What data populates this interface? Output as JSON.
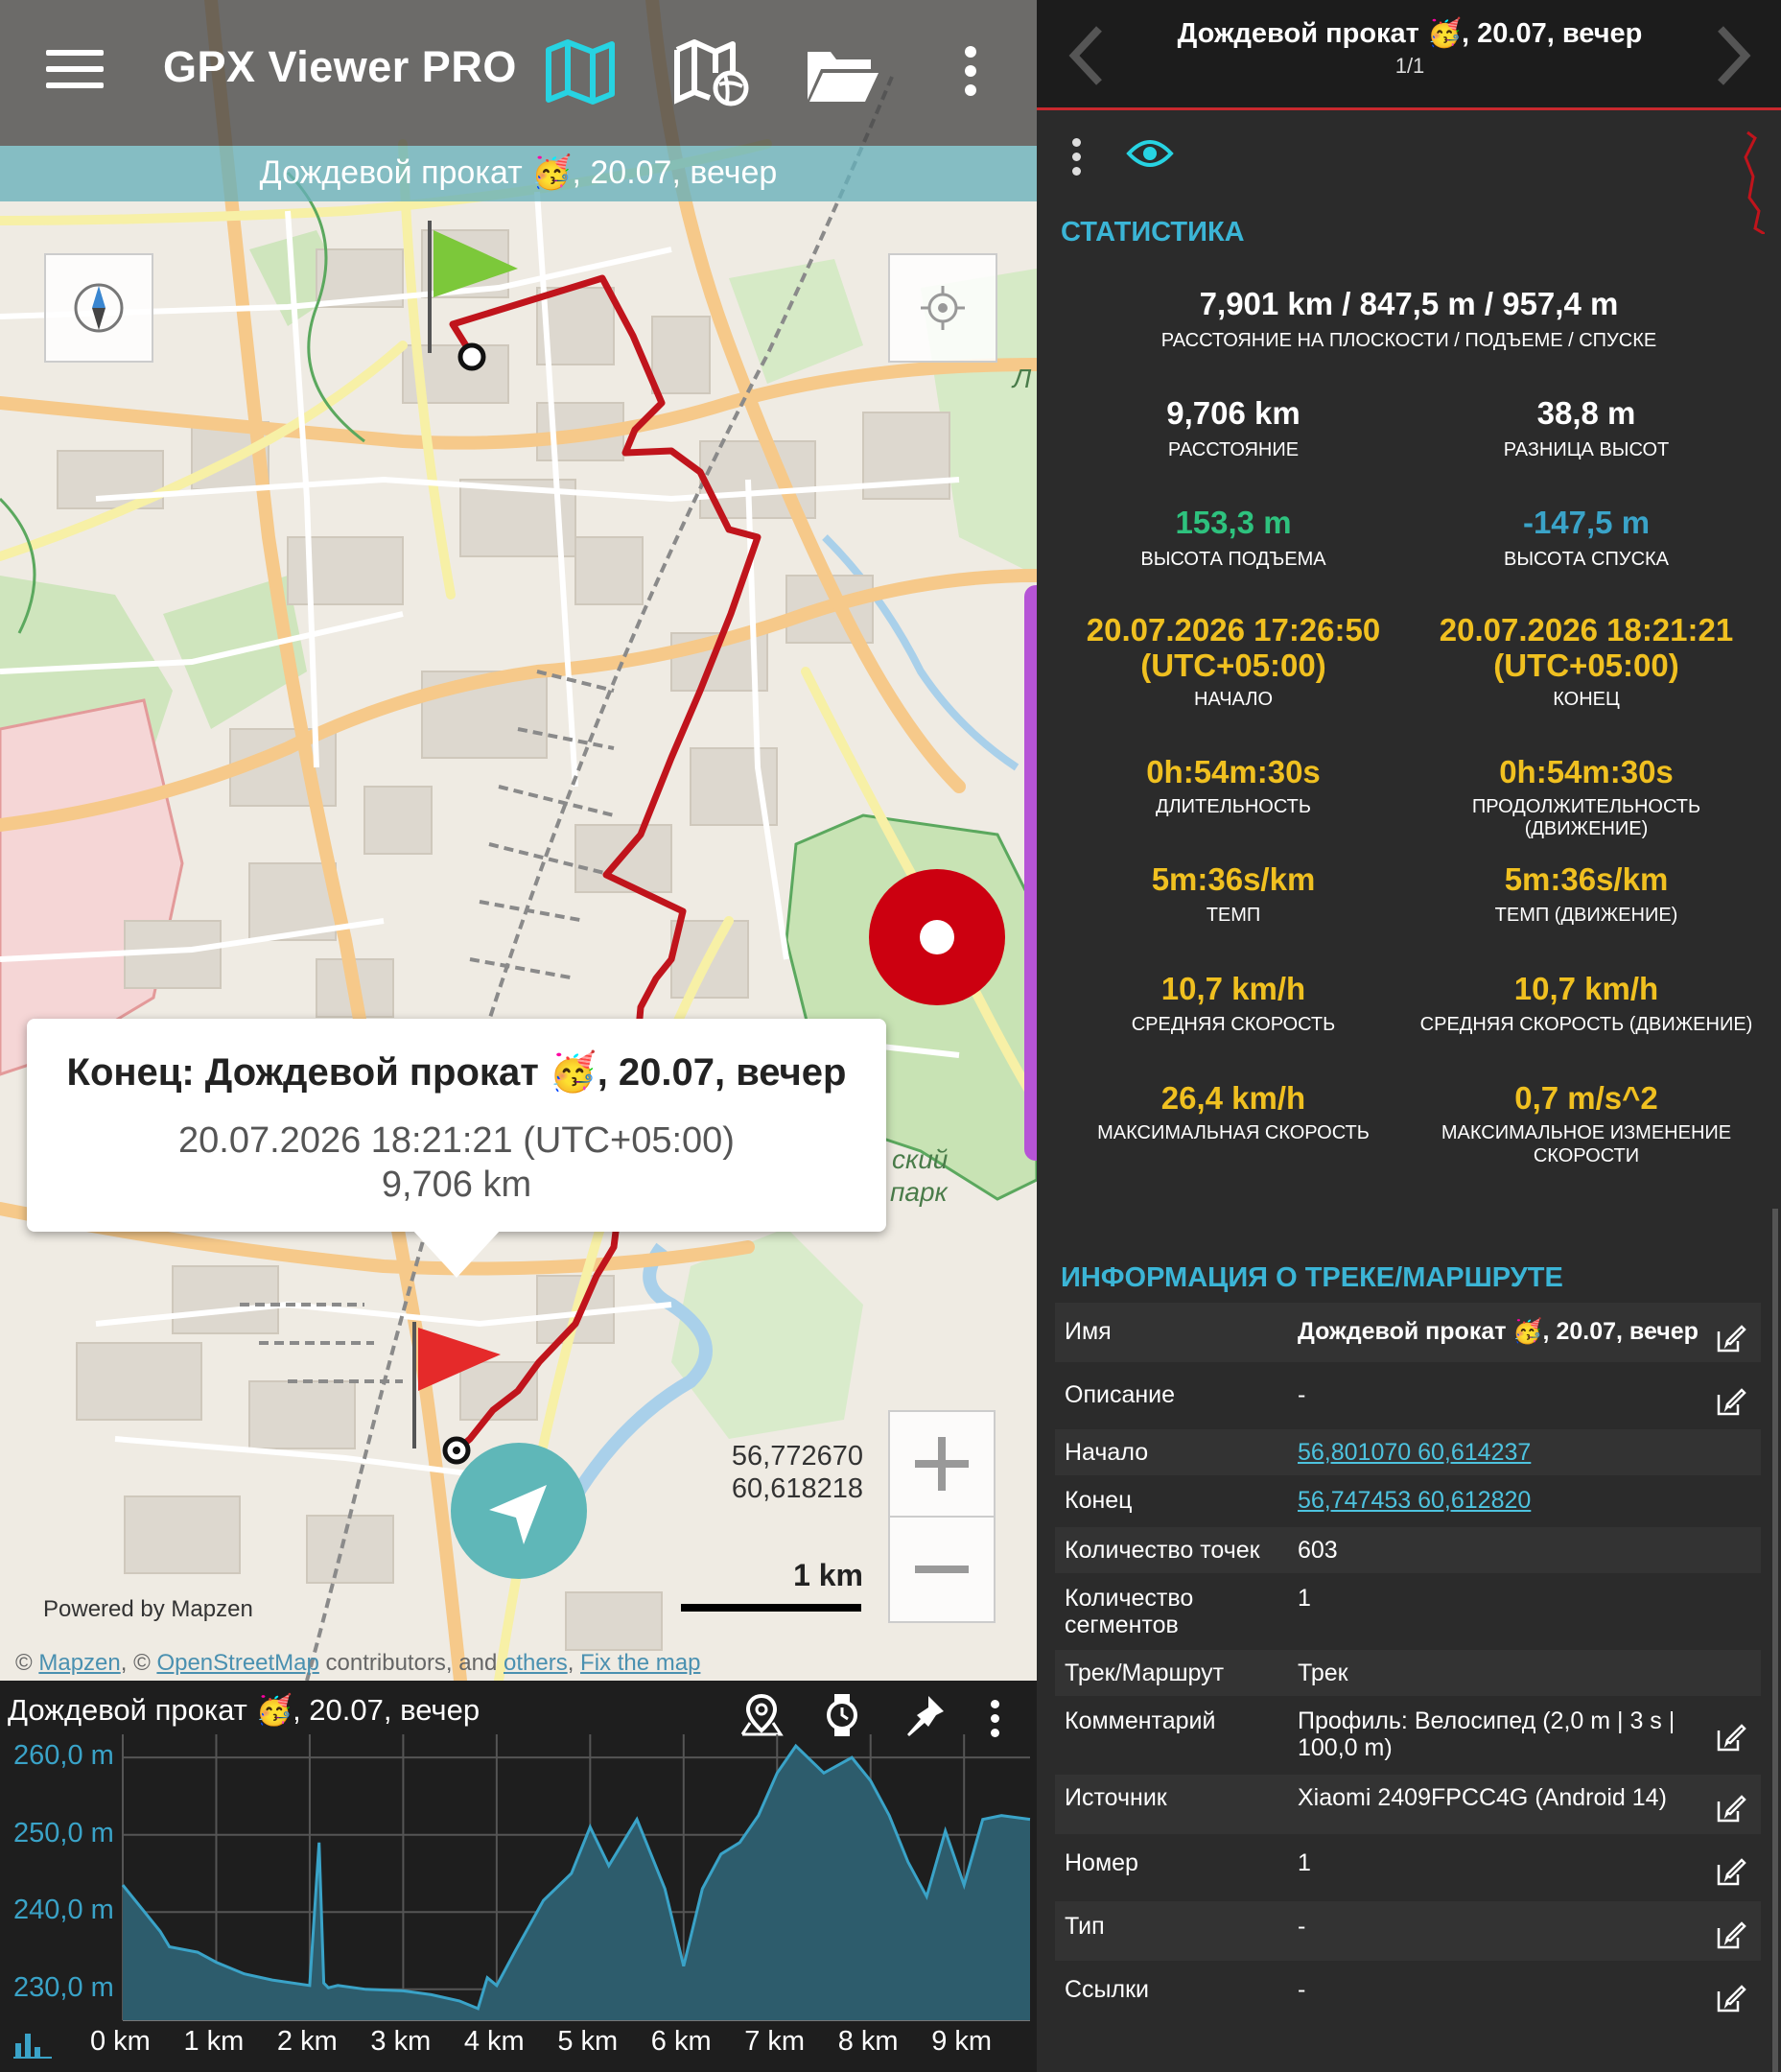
{
  "app": {
    "title": "GPX Viewer PRO",
    "track_banner": "Дождевой прокат 🥳, 20.07, вечер"
  },
  "map": {
    "popup": {
      "title": "Конец: Дождевой прокат 🥳, 20.07, вечер",
      "time": "20.07.2026 18:21:21 (UTC+05:00)",
      "distance": "9,706 km"
    },
    "coords": {
      "lat": "56,772670",
      "lon": "60,618218"
    },
    "scale": "1 km",
    "powered_by": "Powered by Mapzen",
    "attribution": {
      "prefix": "© ",
      "mapzen": "Mapzen",
      "sep1": ", © ",
      "osm": "OpenStreetMap",
      "mid": " contributors, and ",
      "others": "others",
      "sep2": ", ",
      "fix": "Fix the map"
    },
    "labels": {
      "park1": "ский",
      "park2": "парк",
      "edge": "Л"
    },
    "colors": {
      "track": "#c0141c",
      "start_flag": "#7cc83a",
      "end_flag": "#e52a2a",
      "nav_button": "#5fb7b8"
    }
  },
  "elevation": {
    "title": "Дождевой прокат 🥳, 20.07, вечер",
    "tool_icons": [
      "location-pin-icon",
      "watch-icon",
      "pin-icon",
      "more-icon"
    ],
    "y_labels": [
      "260,0 m",
      "250,0 m",
      "240,0 m",
      "230,0 m"
    ],
    "x_labels": [
      "0 km",
      "1 km",
      "2 km",
      "3 km",
      "4 km",
      "5 km",
      "6 km",
      "7 km",
      "8 km",
      "9 km"
    ]
  },
  "chart_data": {
    "type": "area",
    "title": "",
    "xlabel": "",
    "ylabel": "",
    "xlim": [
      0,
      9.706
    ],
    "ylim": [
      226,
      263
    ],
    "x": [
      0,
      0.2,
      0.4,
      0.5,
      0.8,
      1.0,
      1.3,
      1.6,
      2.0,
      2.1,
      2.15,
      2.2,
      2.3,
      2.6,
      3.0,
      3.3,
      3.6,
      3.8,
      3.9,
      4.0,
      4.2,
      4.5,
      4.8,
      5.0,
      5.2,
      5.5,
      5.8,
      6.0,
      6.2,
      6.4,
      6.6,
      6.8,
      7.0,
      7.2,
      7.5,
      7.8,
      8.0,
      8.2,
      8.4,
      8.6,
      8.8,
      9.0,
      9.2,
      9.4,
      9.706
    ],
    "y": [
      243.5,
      240.5,
      237.5,
      235.5,
      234.8,
      233.5,
      232.0,
      231.2,
      230.5,
      249.0,
      230.8,
      230.2,
      230.5,
      230.0,
      229.8,
      229.3,
      228.5,
      227.5,
      231.5,
      230.5,
      235.0,
      241.5,
      245.0,
      251.0,
      246.0,
      252.0,
      243.0,
      233.0,
      243.0,
      247.5,
      249.0,
      252.5,
      258.0,
      261.5,
      258.0,
      260.0,
      257.0,
      252.5,
      246.5,
      242.0,
      250.5,
      243.5,
      252.0,
      252.5,
      252.0
    ],
    "grid": true
  },
  "stats": {
    "header": {
      "title": "Дождевой прокат 🥳, 20.07, вечер",
      "counter": "1/1"
    },
    "section_title": "СТАТИСТИКА",
    "summary": {
      "value": "7,901 km / 847,5 m / 957,4 m",
      "label": "РАССТОЯНИЕ НА ПЛОСКОСТИ / ПОДЪЕМЕ / СПУСКЕ"
    },
    "grid": [
      {
        "left": {
          "value": "9,706 km",
          "label": "РАССТОЯНИЕ"
        },
        "right": {
          "value": "38,8 m",
          "label": "РАЗНИЦА ВЫСОТ"
        }
      },
      {
        "left": {
          "value": "153,3 m",
          "label": "ВЫСОТА ПОДЪЕМА"
        },
        "right": {
          "value": "-147,5 m",
          "label": "ВЫСОТА СПУСКА"
        }
      },
      {
        "left": {
          "value": "20.07.2026 17:26:50",
          "value2": "(UTC+05:00)",
          "label": "НАЧАЛО"
        },
        "right": {
          "value": "20.07.2026 18:21:21",
          "value2": "(UTC+05:00)",
          "label": "КОНЕЦ"
        }
      },
      {
        "left": {
          "value": "0h:54m:30s",
          "label": "ДЛИТЕЛЬНОСТЬ"
        },
        "right": {
          "value": "0h:54m:30s",
          "label": "ПРОДОЛЖИТЕЛЬНОСТЬ (ДВИЖЕНИЕ)"
        }
      },
      {
        "left": {
          "value": "5m:36s/km",
          "label": "ТЕМП"
        },
        "right": {
          "value": "5m:36s/km",
          "label": "ТЕМП (ДВИЖЕНИЕ)"
        }
      },
      {
        "left": {
          "value": "10,7 km/h",
          "label": "СРЕДНЯЯ СКОРОСТЬ"
        },
        "right": {
          "value": "10,7 km/h",
          "label": "СРЕДНЯЯ СКОРОСТЬ (ДВИЖЕНИЕ)"
        }
      },
      {
        "left": {
          "value": "26,4 km/h",
          "label": "МАКСИМАЛЬНАЯ СКОРОСТЬ"
        },
        "right": {
          "value": "0,7 m/s^2",
          "label": "МАКСИМАЛЬНОЕ ИЗМЕНЕНИЕ",
          "label2": "СКОРОСТИ"
        }
      }
    ],
    "colors": {
      "neutral": "#ffffff",
      "ascent": "#2ec27e",
      "descent": "#3aa3c8",
      "time": "#f0c020"
    }
  },
  "info": {
    "section_title": "ИНФОРМАЦИЯ О ТРЕКЕ/МАРШРУТЕ",
    "rows": [
      {
        "key": "Имя",
        "value": "Дождевой прокат 🥳, 20.07, вечер"
      },
      {
        "key": "Описание",
        "value": "-"
      },
      {
        "key": "Начало",
        "value": "56,801070 60,614237"
      },
      {
        "key": "Конец",
        "value": "56,747453 60,612820"
      },
      {
        "key": "Количество точек",
        "value": "603"
      },
      {
        "key": "Количество",
        "key2": "сегментов",
        "value": "1"
      },
      {
        "key": "Трек/Маршрут",
        "value": "Трек"
      },
      {
        "key": "Комментарий",
        "value": "Профиль: Велосипед (2,0 m | 3 s |",
        "value2": "100,0 m)"
      },
      {
        "key": "Источник",
        "value": "Xiaomi 2409FPCC4G (Android 14)"
      },
      {
        "key": "Номер",
        "value": "1"
      },
      {
        "key": "Тип",
        "value": "-"
      },
      {
        "key": "Ссылки",
        "value": "-"
      }
    ]
  }
}
